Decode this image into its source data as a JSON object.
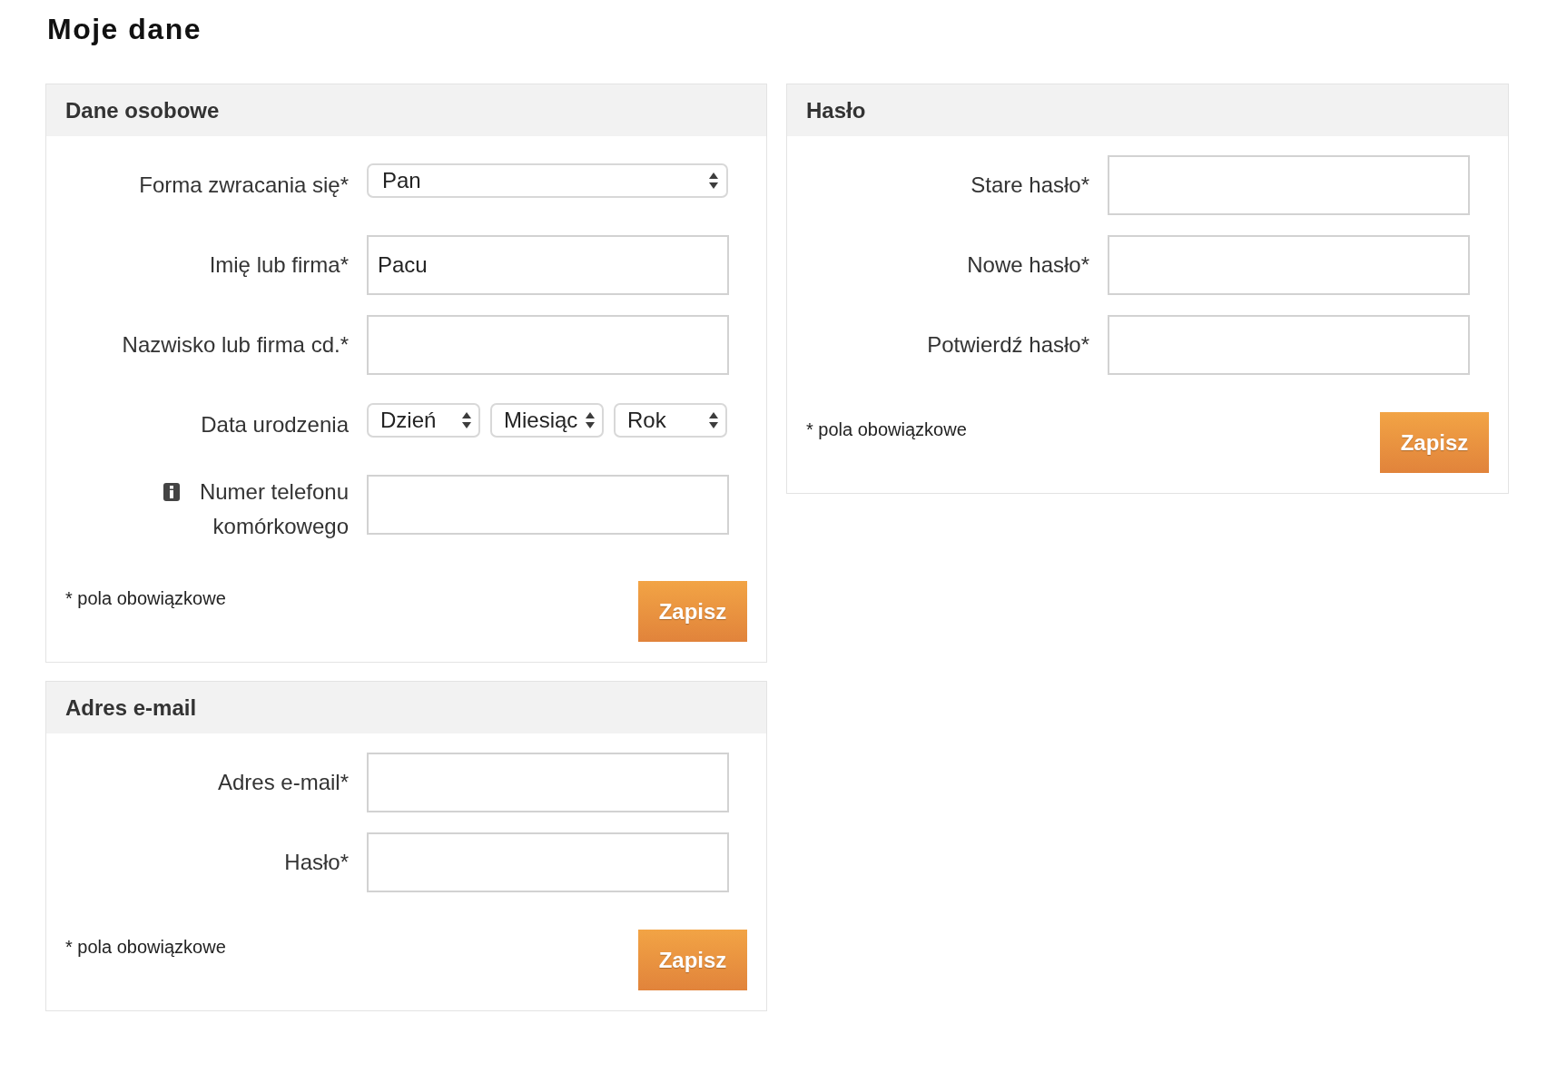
{
  "page": {
    "title": "Moje dane"
  },
  "columns": [
    {
      "panels": [
        {
          "title": "Dane osobowe",
          "fields": [
            {
              "kind": "select",
              "label": "Forma zwracania się*",
              "value": "Pan",
              "help": false
            },
            {
              "kind": "text",
              "label": "Imię lub firma*",
              "value": "Pacu",
              "help": false
            },
            {
              "kind": "text",
              "label": "Nazwisko lub firma cd.*",
              "help": false
            },
            {
              "kind": "date",
              "label": "Data urodzenia",
              "values": [
                "Dzień",
                "Miesiąc",
                "Rok"
              ],
              "help": false
            },
            {
              "kind": "text",
              "label": "Numer telefonu komórkowego",
              "help": true
            }
          ],
          "note": "* pola obowiązkowe",
          "button": "Zapisz"
        },
        {
          "title": "Adres e-mail",
          "fields": [
            {
              "kind": "text",
              "label": "Adres e-mail*",
              "help": false
            },
            {
              "kind": "text",
              "label": "Hasło*",
              "help": false
            }
          ],
          "note": "* pola obowiązkowe",
          "button": "Zapisz"
        }
      ]
    },
    {
      "panels": [
        {
          "title": "Hasło",
          "fields": [
            {
              "kind": "text",
              "label": "Stare hasło*",
              "help": false
            },
            {
              "kind": "text",
              "label": "Nowe hasło*",
              "help": false
            },
            {
              "kind": "text",
              "label": "Potwierdź hasło*",
              "help": false
            }
          ],
          "note": "* pola obowiązkowe",
          "button": "Zapisz"
        }
      ]
    }
  ]
}
